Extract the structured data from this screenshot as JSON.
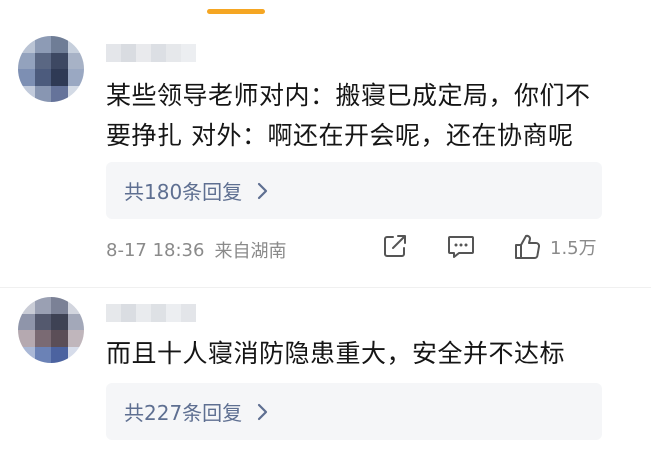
{
  "comments": [
    {
      "text_line1": "某些领导老师对内：搬寝已成定局，你们不",
      "text_line2": "要挣扎 对外：啊还在开会呢，还在协商呢",
      "reply_label": "共180条回复",
      "time": "8-17 18:36",
      "location": "来自湖南",
      "likes": "1.5万"
    },
    {
      "text_line1": "而且十人寝消防隐患重大，安全并不达标",
      "reply_label": "共227条回复"
    }
  ],
  "icons": {
    "share": "share-icon",
    "comment": "comment-icon",
    "like": "thumbs-up-icon",
    "chevron": "chevron-right-icon"
  },
  "colors": {
    "accent": "#f5a623",
    "reply_text": "#5e6f91",
    "reply_bg": "#f5f6f8",
    "meta_text": "#8a8a8a"
  }
}
